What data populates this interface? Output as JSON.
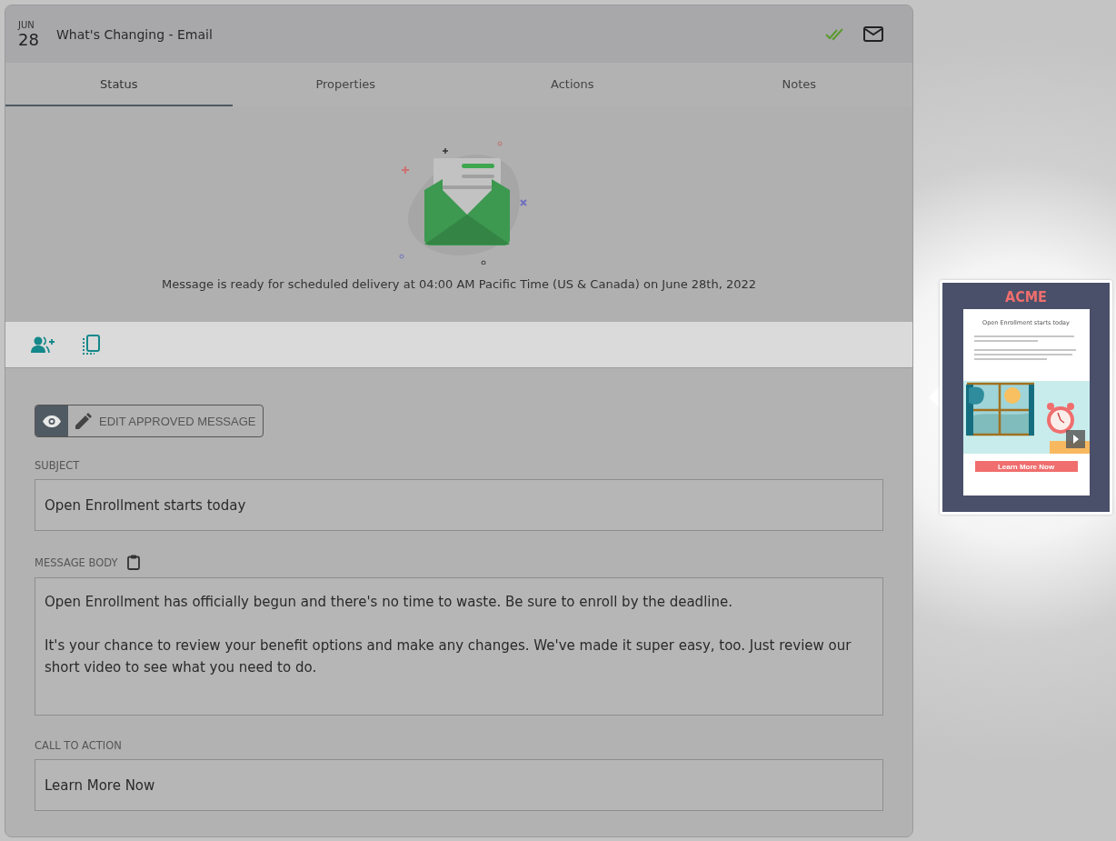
{
  "header": {
    "month": "JUN",
    "day": "28",
    "title": "What's Changing - Email",
    "approved": true
  },
  "tabs": [
    {
      "label": "Status",
      "selected": true
    },
    {
      "label": "Properties",
      "selected": false
    },
    {
      "label": "Actions",
      "selected": false
    },
    {
      "label": "Notes",
      "selected": false
    }
  ],
  "status": {
    "message": "Message is ready for scheduled delivery at 04:00 AM Pacific Time (US & Canada) on June 28th, 2022"
  },
  "edit_button": {
    "label": "EDIT APPROVED MESSAGE"
  },
  "fields": [
    {
      "label": "SUBJECT",
      "kind": "single",
      "paragraphs": [
        "Open Enrollment starts today"
      ]
    },
    {
      "label": "MESSAGE BODY",
      "kind": "multi",
      "paragraphs": [
        "Open Enrollment has officially begun and there's no time to waste. Be sure to enroll by the deadline.",
        "It's your chance to review your benefit options and make any changes. We've made it super easy, too. Just review our short video to see what you need to do."
      ]
    },
    {
      "label": "CALL TO ACTION",
      "kind": "single",
      "paragraphs": [
        "Learn More Now"
      ]
    }
  ],
  "preview": {
    "brand": "ACME",
    "heading": "Open Enrollment starts today",
    "button": "Learn More Now"
  }
}
